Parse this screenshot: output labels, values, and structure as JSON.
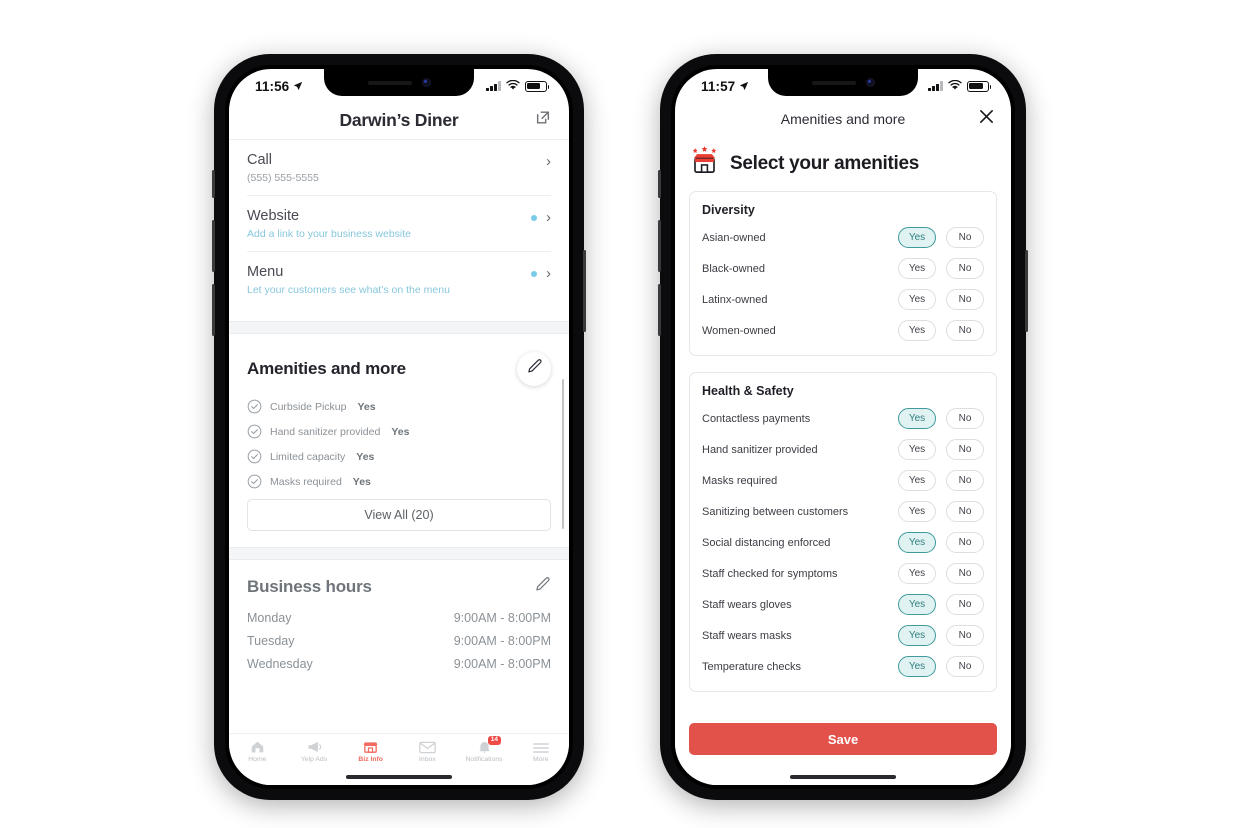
{
  "colors": {
    "brand_red": "#e2514a",
    "nav_active_red": "#f26b62",
    "teal_selected_border": "#3f9a9c",
    "teal_selected_bg": "#e1f2f2",
    "blue_dot": "#79cbe8"
  },
  "left_phone": {
    "status_bar": {
      "time": "11:56",
      "location_icon": "location-arrow-icon",
      "signal_icon": "cellular-signal-icon",
      "wifi_icon": "wifi-icon",
      "battery_icon": "battery-icon"
    },
    "header": {
      "title": "Darwin’s Diner",
      "share_icon": "external-link-icon"
    },
    "rows": [
      {
        "title": "Call",
        "subtitle": "(555) 555-5555",
        "subtitle_is_link": false,
        "dot": false
      },
      {
        "title": "Website",
        "subtitle": "Add a link to your business website",
        "subtitle_is_link": true,
        "dot": true
      },
      {
        "title": "Menu",
        "subtitle": "Let your customers see what’s on the menu",
        "subtitle_is_link": true,
        "dot": true
      }
    ],
    "amenities_section": {
      "title": "Amenities and more",
      "edit_icon": "pencil-icon",
      "items": [
        {
          "label": "Curbside Pickup",
          "value": "Yes"
        },
        {
          "label": "Hand sanitizer provided",
          "value": "Yes"
        },
        {
          "label": "Limited capacity",
          "value": "Yes"
        },
        {
          "label": "Masks required",
          "value": "Yes"
        }
      ],
      "view_all_label": "View All (20)"
    },
    "hours_section": {
      "title": "Business hours",
      "edit_icon": "pencil-icon",
      "rows": [
        {
          "day": "Monday",
          "hours": "9:00AM - 8:00PM"
        },
        {
          "day": "Tuesday",
          "hours": "9:00AM - 8:00PM"
        },
        {
          "day": "Wednesday",
          "hours": "9:00AM - 8:00PM"
        }
      ]
    },
    "tabbar": [
      {
        "label": "Home",
        "icon": "home-icon",
        "active": false,
        "badge": null
      },
      {
        "label": "Yelp Ads",
        "icon": "megaphone-icon",
        "active": false,
        "badge": null
      },
      {
        "label": "Biz Info",
        "icon": "storefront-icon",
        "active": true,
        "badge": null
      },
      {
        "label": "Inbox",
        "icon": "envelope-icon",
        "active": false,
        "badge": null
      },
      {
        "label": "Notifications",
        "icon": "bell-icon",
        "active": false,
        "badge": "14"
      },
      {
        "label": "More",
        "icon": "hamburger-menu-icon",
        "active": false,
        "badge": null
      }
    ]
  },
  "right_phone": {
    "status_bar": {
      "time": "11:57",
      "location_icon": "location-arrow-icon",
      "signal_icon": "cellular-signal-icon",
      "wifi_icon": "wifi-icon",
      "battery_icon": "battery-icon"
    },
    "header": {
      "title": "Amenities and more",
      "close_icon": "close-icon"
    },
    "page_heading": {
      "text": "Select your amenities",
      "icon": "storefront-stars-icon"
    },
    "sections": [
      {
        "title": "Diversity",
        "rows": [
          {
            "label": "Asian-owned",
            "yes_label": "Yes",
            "no_label": "No",
            "selected": "yes"
          },
          {
            "label": "Black-owned",
            "yes_label": "Yes",
            "no_label": "No",
            "selected": null
          },
          {
            "label": "Latinx-owned",
            "yes_label": "Yes",
            "no_label": "No",
            "selected": null
          },
          {
            "label": "Women-owned",
            "yes_label": "Yes",
            "no_label": "No",
            "selected": null
          }
        ]
      },
      {
        "title": "Health & Safety",
        "rows": [
          {
            "label": "Contactless payments",
            "yes_label": "Yes",
            "no_label": "No",
            "selected": "yes"
          },
          {
            "label": "Hand sanitizer provided",
            "yes_label": "Yes",
            "no_label": "No",
            "selected": null
          },
          {
            "label": "Masks required",
            "yes_label": "Yes",
            "no_label": "No",
            "selected": null
          },
          {
            "label": "Sanitizing between customers",
            "yes_label": "Yes",
            "no_label": "No",
            "selected": null
          },
          {
            "label": "Social distancing enforced",
            "yes_label": "Yes",
            "no_label": "No",
            "selected": "yes"
          },
          {
            "label": "Staff checked for symptoms",
            "yes_label": "Yes",
            "no_label": "No",
            "selected": null
          },
          {
            "label": "Staff wears gloves",
            "yes_label": "Yes",
            "no_label": "No",
            "selected": "yes"
          },
          {
            "label": "Staff wears masks",
            "yes_label": "Yes",
            "no_label": "No",
            "selected": "yes"
          },
          {
            "label": "Temperature checks",
            "yes_label": "Yes",
            "no_label": "No",
            "selected": "yes"
          }
        ]
      }
    ],
    "save_label": "Save"
  }
}
